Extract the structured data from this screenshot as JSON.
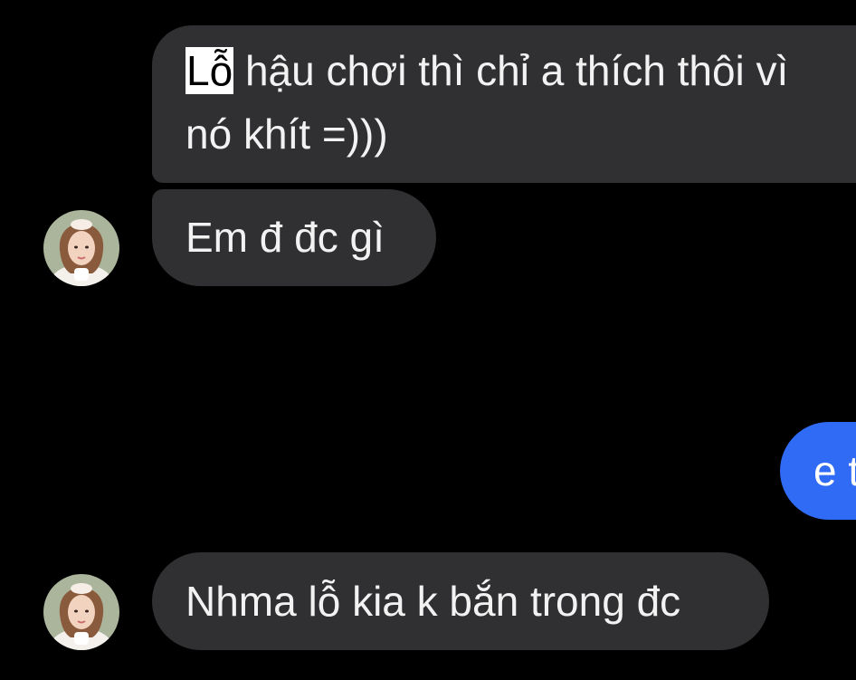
{
  "messages": [
    {
      "highlight": "Lỗ",
      "line1_rest": " hậu chơi thì chỉ a thích thôi vì",
      "line2": "nó khít =)))"
    },
    {
      "text": "Em đ đc gì"
    },
    {
      "text": "e t"
    },
    {
      "text": "Nhma lỗ kia k bắn trong đc"
    }
  ],
  "colors": {
    "background": "#000000",
    "incoming_bubble": "#303033",
    "outgoing_bubble": "#2f6bf4",
    "highlight": "#ffffff"
  }
}
